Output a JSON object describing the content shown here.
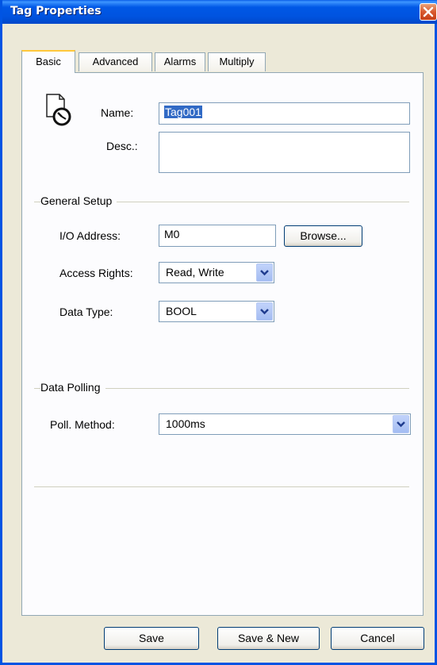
{
  "window": {
    "title": "Tag Properties"
  },
  "tabs": [
    {
      "label": "Basic",
      "active": true
    },
    {
      "label": "Advanced"
    },
    {
      "label": "Alarms"
    },
    {
      "label": "Multiply"
    }
  ],
  "basic": {
    "name_label": "Name:",
    "name_value": "Tag001",
    "desc_label": "Desc.:",
    "desc_value": ""
  },
  "general_setup": {
    "title": "General Setup",
    "io_address_label": "I/O Address:",
    "io_address_value": "M0",
    "browse_label": "Browse...",
    "access_rights_label": "Access Rights:",
    "access_rights_value": "Read, Write",
    "data_type_label": "Data Type:",
    "data_type_value": "BOOL"
  },
  "data_polling": {
    "title": "Data Polling",
    "poll_method_label": "Poll. Method:",
    "poll_method_value": "1000ms"
  },
  "footer": {
    "save_label": "Save",
    "save_new_label": "Save & New",
    "cancel_label": "Cancel"
  },
  "colors": {
    "titlebar": "#0058E6",
    "close_button": "#D9592E",
    "selection": "#316AC5",
    "active_tab_accent": "#FFC83C"
  },
  "icons": {
    "title_close": "close-icon",
    "tag": "tag-document-icon",
    "dropdown": "chevron-down-icon"
  }
}
